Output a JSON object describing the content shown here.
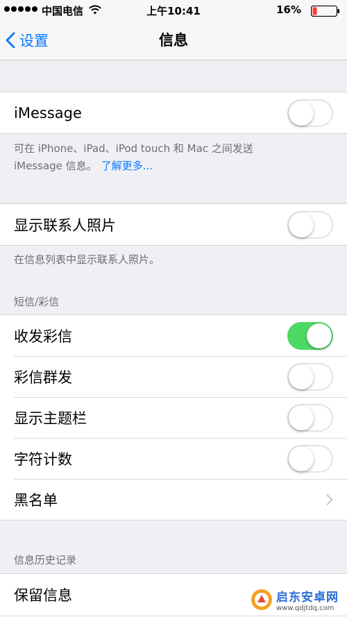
{
  "status_bar": {
    "carrier": "中国电信",
    "time": "上午10:41",
    "battery": "16%"
  },
  "nav": {
    "back_label": "设置",
    "title": "信息"
  },
  "imessage": {
    "label": "iMessage",
    "enabled": false,
    "footer_line1": "可在 iPhone、iPad、iPod touch 和 Mac 之间发送",
    "footer_line2": "iMessage 信息。",
    "learn_more": "了解更多..."
  },
  "contact_photos": {
    "label": "显示联系人照片",
    "enabled": false,
    "footer": "在信息列表中显示联系人照片。"
  },
  "sms_mms": {
    "header": "短信/彩信",
    "items": [
      {
        "label": "收发彩信",
        "enabled": true
      },
      {
        "label": "彩信群发",
        "enabled": false
      },
      {
        "label": "显示主题栏",
        "enabled": false
      },
      {
        "label": "字符计数",
        "enabled": false
      },
      {
        "label": "黑名单"
      }
    ]
  },
  "history": {
    "header": "信息历史记录",
    "items": [
      {
        "label": "保留信息"
      }
    ]
  },
  "watermark": {
    "title": "启东安卓网",
    "url": "www.qdjtdq.com"
  },
  "colors": {
    "accent": "#0a7aff",
    "toggle_on": "#4cd964",
    "background": "#efeff4"
  }
}
